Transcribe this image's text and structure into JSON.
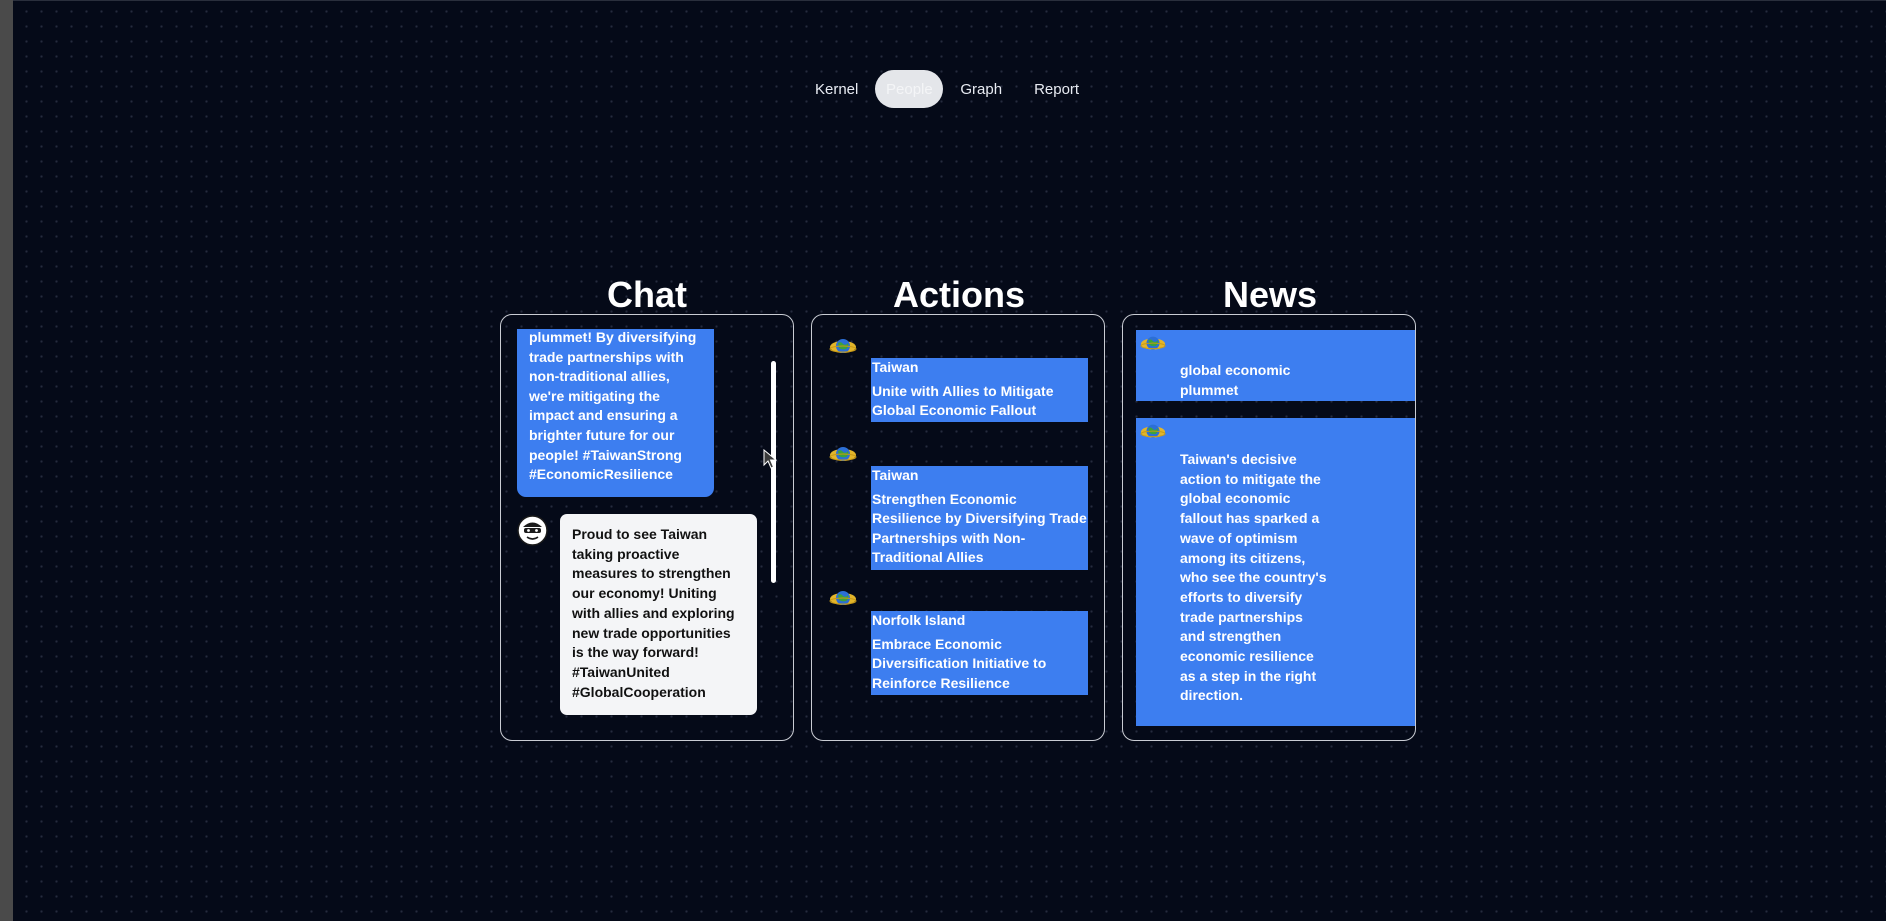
{
  "nav": {
    "tabs": [
      {
        "label": "Kernel",
        "active": false
      },
      {
        "label": "People",
        "active": true
      },
      {
        "label": "Graph",
        "active": false
      },
      {
        "label": "Report",
        "active": false
      }
    ]
  },
  "chat": {
    "title": "Chat",
    "messages": [
      {
        "style": "blue",
        "text": "plummet! By diversifying trade partnerships with non-traditional allies, we're mitigating the impact and ensuring a brighter future for our people! #TaiwanStrong #EconomicResilience"
      },
      {
        "style": "white",
        "avatar_icon": "masked-face-avatar-icon",
        "text": "Proud to see Taiwan taking proactive measures to strengthen our economy! Uniting with allies and exploring new trade opportunities is the way forward! #TaiwanUnited #GlobalCooperation"
      }
    ]
  },
  "actions": {
    "title": "Actions",
    "items": [
      {
        "icon": "globe-icon",
        "actor": "Taiwan",
        "action": "Unite with Allies to Mitigate Global Economic Fallout"
      },
      {
        "icon": "globe-icon",
        "actor": "Taiwan",
        "action": "Strengthen Economic Resilience by Diversifying Trade Partnerships with Non-Traditional Allies"
      },
      {
        "icon": "globe-icon",
        "actor": "Norfolk Island",
        "action": "Embrace Economic Diversification Initiative to Reinforce Resilience"
      }
    ]
  },
  "news": {
    "title": "News",
    "items": [
      {
        "icon": "globe-icon",
        "text": "global economic plummet"
      },
      {
        "icon": "globe-icon",
        "text": "Taiwan's decisive action to mitigate the global economic fallout has sparked a wave of optimism among its citizens, who see the country's efforts to diversify trade partnerships and strengthen economic resilience as a step in the right direction."
      }
    ]
  },
  "colors": {
    "background": "#050a18",
    "accent_blue": "#3d7ef0",
    "bubble_white": "#f4f5f7",
    "panel_border": "#c9ccd3"
  }
}
